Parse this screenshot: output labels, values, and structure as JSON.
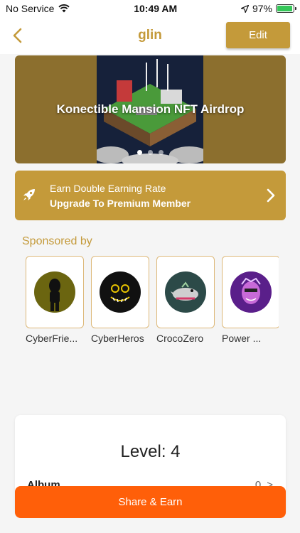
{
  "status": {
    "carrier": "No Service",
    "time": "10:49 AM",
    "battery": "97%",
    "battery_level": 0.97
  },
  "nav": {
    "title": "glin",
    "edit_label": "Edit"
  },
  "banner": {
    "title": "Konectible Mansion NFT Airdrop",
    "slide_count": 3,
    "active_slide": 1
  },
  "premium": {
    "line1": "Earn Double Earning Rate",
    "line2": "Upgrade To Premium Member"
  },
  "sponsored": {
    "title": "Sponsored by",
    "items": [
      {
        "name": "CyberFrie...",
        "avatar_color": "#6b6510"
      },
      {
        "name": "CyberHeros",
        "avatar_color": "#111111"
      },
      {
        "name": "CrocoZero",
        "avatar_color": "#2c4a48"
      },
      {
        "name": "Power ...",
        "avatar_color": "#7a2aa0"
      }
    ]
  },
  "level": {
    "text": "Level: 4",
    "album_label": "Album",
    "album_count": "0",
    "album_arrow": ">"
  },
  "share": {
    "label": "Share & Earn"
  },
  "colors": {
    "brand": "#c49a3a",
    "banner_bg": "#8c6f2e",
    "share": "#ff5f09"
  }
}
